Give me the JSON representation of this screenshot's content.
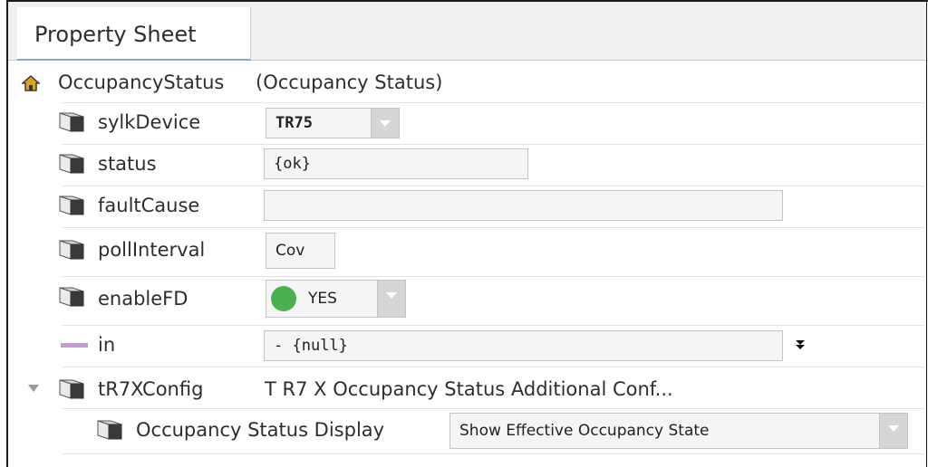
{
  "tab": {
    "label": "Property Sheet"
  },
  "root": {
    "name": "OccupancyStatus",
    "display": "(Occupancy Status)"
  },
  "properties": {
    "sylkDevice": {
      "label": "sylkDevice",
      "value": "TR75"
    },
    "status": {
      "label": "status",
      "value": "{ok}"
    },
    "faultCause": {
      "label": "faultCause",
      "value": ""
    },
    "pollInterval": {
      "label": "pollInterval",
      "value": "Cov"
    },
    "enableFD": {
      "label": "enableFD",
      "value": "YES",
      "status_color": "#4caf50"
    },
    "in": {
      "label": "in",
      "value": "- {null}",
      "slot_color": "#c39bd3"
    },
    "tR7XConfig": {
      "label": "tR7XConfig",
      "value": "T R7 X Occupancy Status Additional Conf..."
    },
    "occupancyStatusDisplay": {
      "label": "Occupancy Status Display",
      "value": "Show Effective Occupancy State"
    }
  },
  "icons": {
    "root": "home-icon",
    "property": "cube-icon",
    "link": "link-slot-icon",
    "expand": "expand-triangle-icon",
    "more": "double-chevron-down-icon"
  }
}
